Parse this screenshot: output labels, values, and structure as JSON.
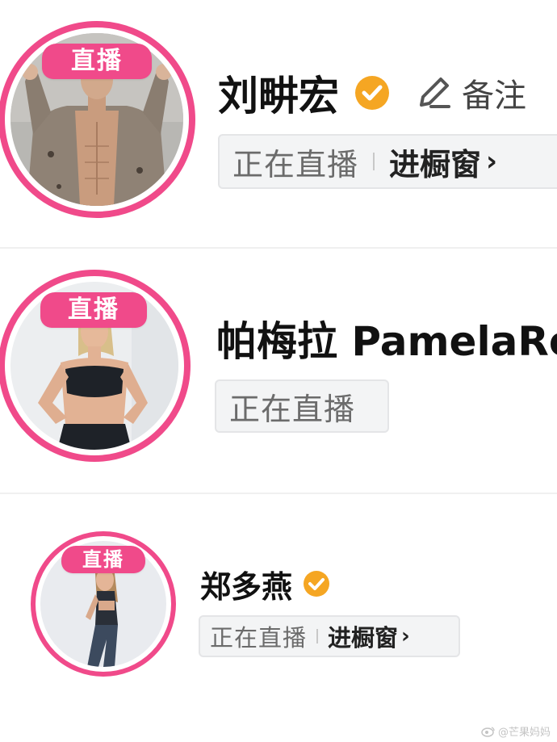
{
  "live_tag_label": "直播",
  "creators": [
    {
      "name": "刘畊宏",
      "verified": true,
      "remark_label": "备注",
      "status": "正在直播",
      "shop_label": "进橱窗",
      "avatar_icon": "man-in-open-jacket-photo"
    },
    {
      "name": "帕梅拉 PamelaRe",
      "verified": false,
      "status": "正在直播",
      "avatar_icon": "woman-in-sports-bra-photo"
    },
    {
      "name": "郑多燕",
      "verified": true,
      "status": "正在直播",
      "shop_label": "进橱窗",
      "avatar_icon": "woman-standing-side-photo"
    }
  ],
  "watermark": "@芒果妈妈",
  "colors": {
    "live_pink": "#f04a8a",
    "verified_gold": "#f5a623",
    "chip_bg": "#f3f4f5"
  }
}
